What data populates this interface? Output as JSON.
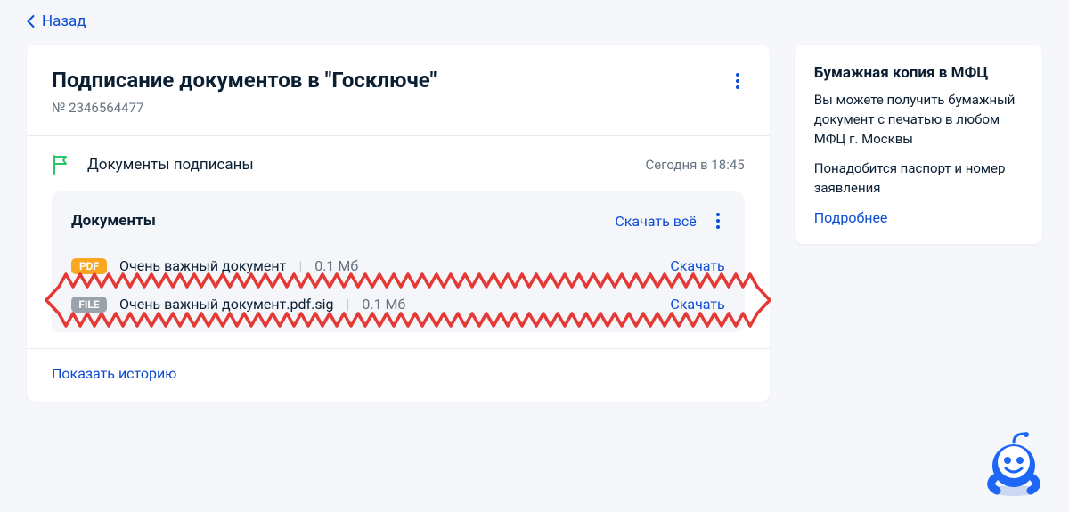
{
  "back_label": "Назад",
  "main": {
    "title": "Подписание документов в \"Госключе\"",
    "request_number": "№ 2346564477",
    "status_label": "Документы подписаны",
    "status_time": "Сегодня в 18:45",
    "show_history": "Показать историю"
  },
  "docs": {
    "title": "Документы",
    "download_all": "Скачать всё",
    "items": [
      {
        "badge": "PDF",
        "name": "Очень важный документ",
        "size": "0.1 Мб",
        "download": "Скачать"
      },
      {
        "badge": "FILE",
        "name": "Очень важный документ.pdf.sig",
        "size": "0.1 Мб",
        "download": "Скачать"
      }
    ]
  },
  "side": {
    "title": "Бумажная копия в МФЦ",
    "p1": "Вы можете получить бумажный документ с печатью в любом МФЦ г. Москвы",
    "p2": "Понадобится паспорт и номер заявления",
    "more": "Подробнее"
  }
}
